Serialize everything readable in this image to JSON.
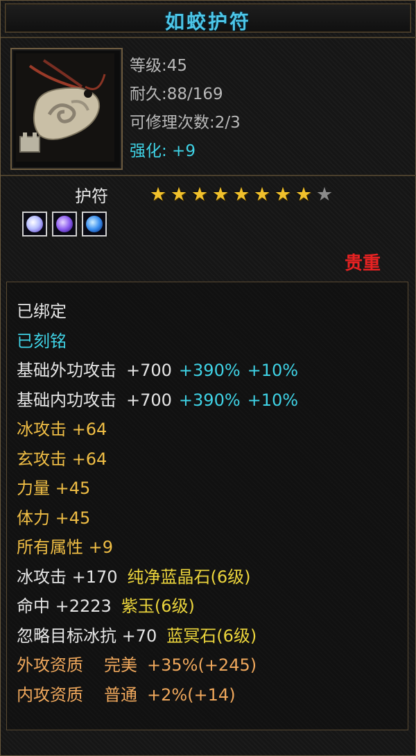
{
  "title": "如蛟护符",
  "stats": {
    "level": "等级:45",
    "durability": "耐久:88/169",
    "repair": "可修理次数:2/3",
    "enhance": "强化: +9"
  },
  "item_type": "护符",
  "stars": {
    "filled": 8,
    "total": 9
  },
  "gems": [
    "white-gem",
    "purple-gem",
    "blue-gem"
  ],
  "quality": "贵重",
  "properties": {
    "bound": "已绑定",
    "engraved": "已刻铭",
    "base_outer": {
      "label": "基础外功攻击",
      "value": "+700",
      "pct": "+390%",
      "bonus": "+10%"
    },
    "base_inner": {
      "label": "基础内功攻击",
      "value": "+700",
      "pct": "+390%",
      "bonus": "+10%"
    },
    "ice": "冰攻击 +64",
    "xuan": "玄攻击 +64",
    "strength": "力量 +45",
    "stamina": "体力 +45",
    "all_attr": "所有属性 +9",
    "gem_ice": {
      "stat": "冰攻击 +170",
      "gem": "纯净蓝晶石(6级)"
    },
    "gem_hit": {
      "stat": "命中 +2223",
      "gem": "紫玉(6级)"
    },
    "gem_ignore": {
      "stat": "忽略目标冰抗 +70",
      "gem": "蓝冥石(6级)"
    },
    "outer_quality": {
      "label": "外攻资质",
      "grade": "完美",
      "value": "+35%(+245)"
    },
    "inner_quality": {
      "label": "内攻资质",
      "grade": "普通",
      "value": "+2%(+14)"
    }
  },
  "colors": {
    "title": "#4cc6e8",
    "cyan": "#3fd3e6",
    "gold": "#f0be45",
    "orange": "#f0a85c",
    "yellow": "#ecd53c",
    "quality": "#e82222"
  }
}
